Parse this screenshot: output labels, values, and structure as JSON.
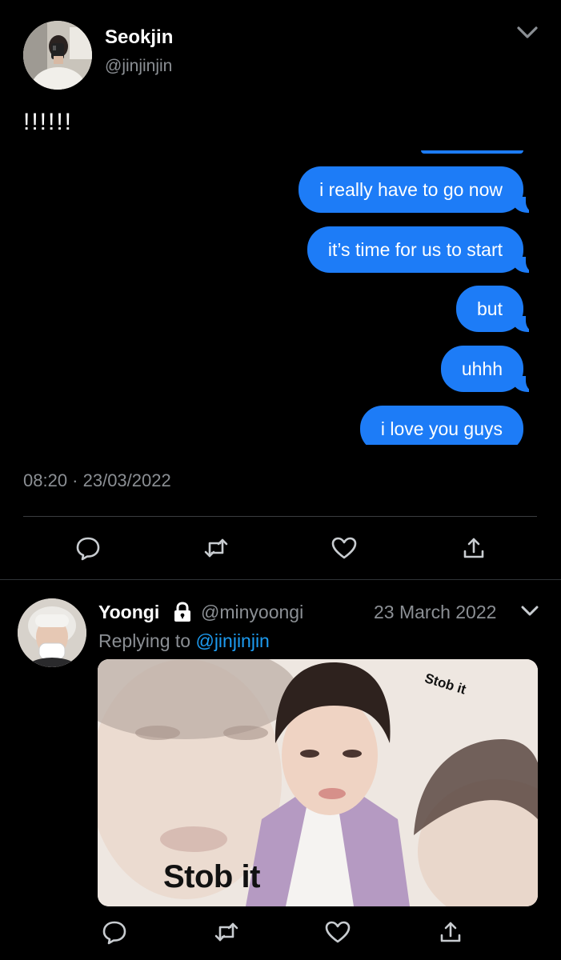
{
  "tweet1": {
    "display_name": "Seokjin",
    "handle": "@jinjinjin",
    "text": "!!!!!!",
    "messages": [
      "i really have to go now",
      "it’s time for us to start",
      "but",
      "uhhh",
      "i love you guys"
    ],
    "timestamp": "08:20 · 23/03/2022",
    "actions": [
      "reply-icon",
      "retweet-icon",
      "like-icon",
      "share-icon"
    ]
  },
  "tweet2": {
    "display_name": "Yoongi",
    "protected_icon": "lock-icon",
    "handle": "@minyoongi",
    "date": "23 March 2022",
    "replying_prefix": "Replying to",
    "replying_to": "@jinjinjin",
    "media_caption_main": "Stob it",
    "media_caption_corner": "Stob it",
    "actions": [
      "reply-icon",
      "retweet-icon",
      "like-icon",
      "share-icon"
    ]
  },
  "colors": {
    "background": "#000000",
    "bubble": "#1d7cf7",
    "muted_text": "#8b8f94",
    "link": "#1d9bf0"
  }
}
